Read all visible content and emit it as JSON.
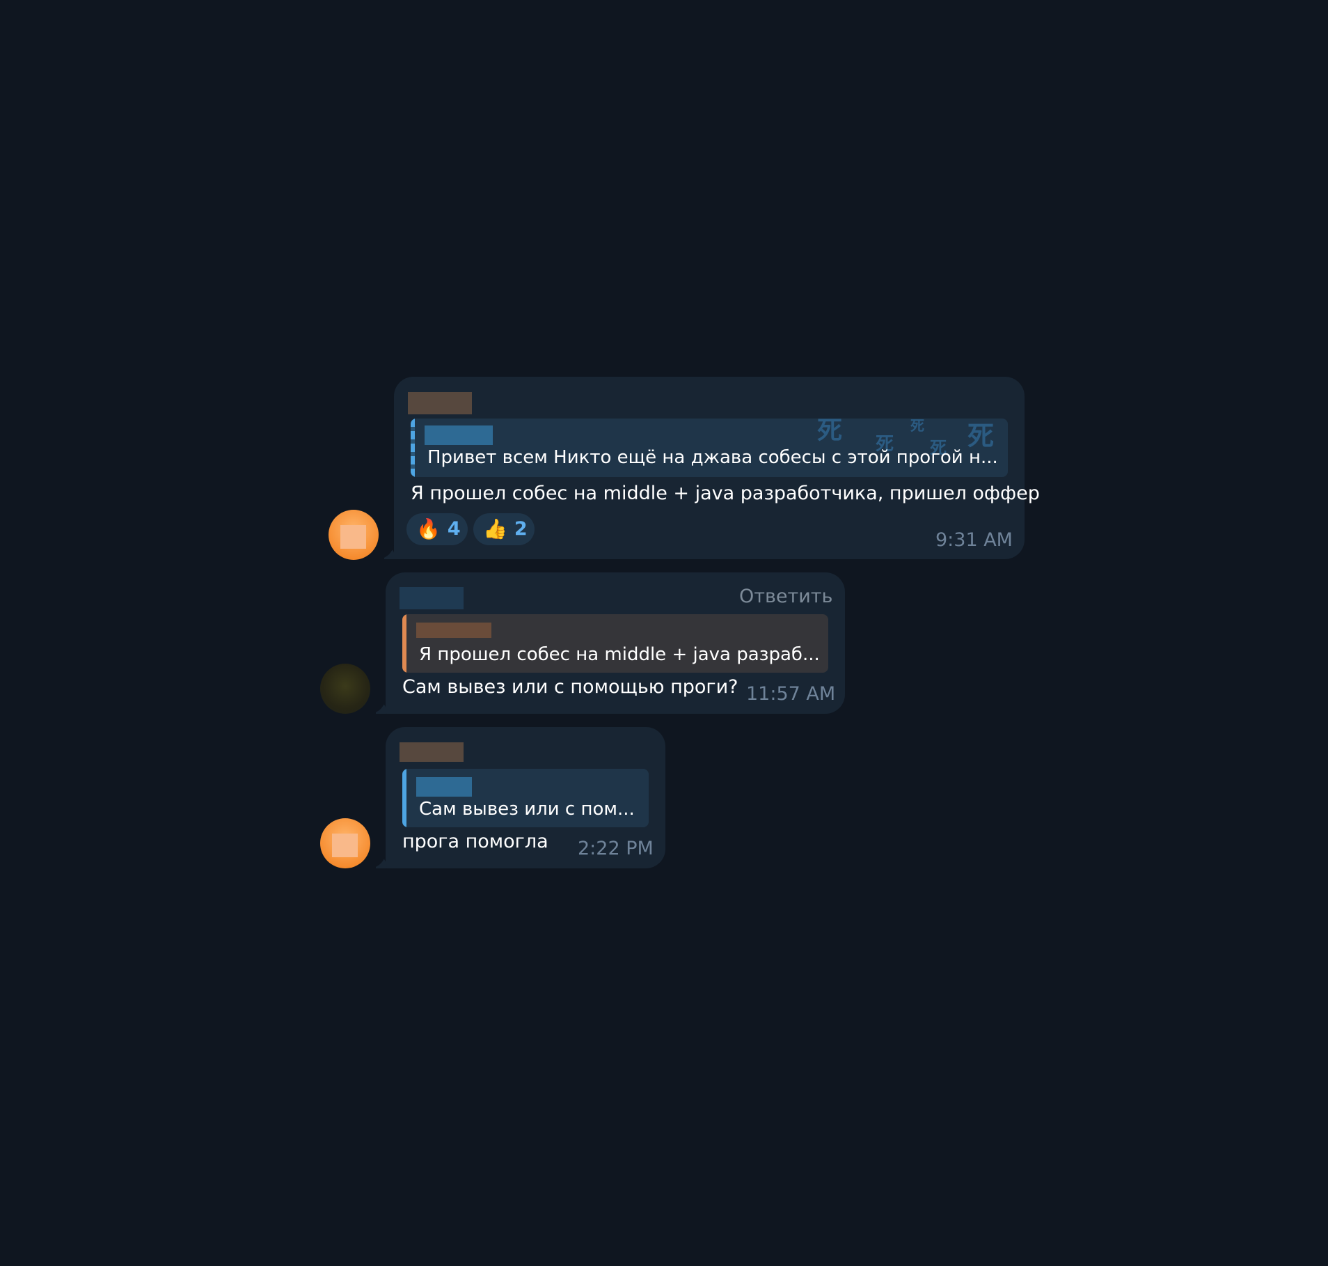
{
  "messages": [
    {
      "reply_quote_text": "Привет всем Никто ещё на джава собесы с этой прогой н...",
      "text": "Я прошел собес на middle + java разработчика, пришел оффер",
      "time": "9:31 AM",
      "reactions": [
        {
          "emoji": "🔥",
          "count": "4"
        },
        {
          "emoji": "👍",
          "count": "2"
        }
      ],
      "quote_decoration_glyph": "死"
    },
    {
      "reply_link": "Ответить",
      "reply_quote_text": "Я прошел собес на middle + java разраб...",
      "text": "Сам вывез или с помощью проги?",
      "time": "11:57 AM"
    },
    {
      "reply_quote_text": "Сам вывез или с пом...",
      "text": "прога помогла",
      "time": "2:22 PM"
    }
  ],
  "colors": {
    "background": "#0f1620",
    "bubble": "#182533",
    "quote_blue": "#1f3549",
    "quote_orange": "#353539",
    "accent_blue": "#4ea5e3",
    "accent_orange": "#e08a52",
    "time_text": "#6f8399",
    "reaction_count": "#5fb0f0"
  }
}
